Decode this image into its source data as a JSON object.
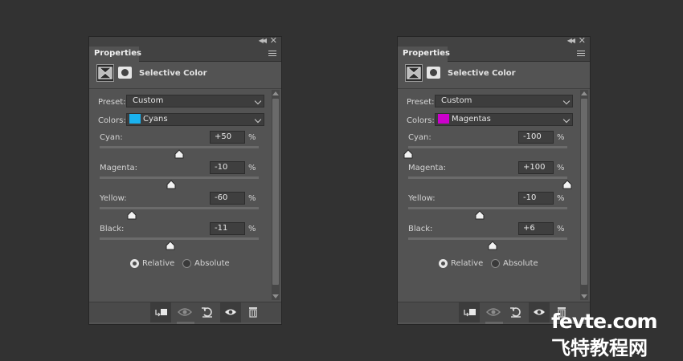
{
  "panels": [
    {
      "tab": "Properties",
      "adjustment_title": "Selective Color",
      "preset_label": "Preset:",
      "preset_value": "Custom",
      "colors_label": "Colors:",
      "colors_value": "Cyans",
      "colors_swatch": "#1ab2ef",
      "sliders": [
        {
          "label": "Cyan:",
          "value": "+50",
          "unit": "%",
          "position": 0.5
        },
        {
          "label": "Magenta:",
          "value": "-10",
          "unit": "%",
          "position": 0.45
        },
        {
          "label": "Yellow:",
          "value": "-60",
          "unit": "%",
          "position": 0.2
        },
        {
          "label": "Black:",
          "value": "-11",
          "unit": "%",
          "position": 0.445
        }
      ],
      "method_relative": "Relative",
      "method_absolute": "Absolute",
      "method_selected": "Relative"
    },
    {
      "tab": "Properties",
      "adjustment_title": "Selective Color",
      "preset_label": "Preset:",
      "preset_value": "Custom",
      "colors_label": "Colors:",
      "colors_value": "Magentas",
      "colors_swatch": "#cc00cc",
      "sliders": [
        {
          "label": "Cyan:",
          "value": "-100",
          "unit": "%",
          "position": 0.0
        },
        {
          "label": "Magenta:",
          "value": "+100",
          "unit": "%",
          "position": 1.0
        },
        {
          "label": "Yellow:",
          "value": "-10",
          "unit": "%",
          "position": 0.45
        },
        {
          "label": "Black:",
          "value": "+6",
          "unit": "%",
          "position": 0.53
        }
      ],
      "method_relative": "Relative",
      "method_absolute": "Absolute",
      "method_selected": "Relative"
    }
  ],
  "icons": {
    "collapse": "double-chevron-left-icon",
    "close": "close-icon",
    "menu": "panel-menu-icon",
    "adjustment": "selective-color-layer-icon",
    "mask": "layer-mask-icon",
    "clip": "clip-to-layer-icon",
    "view_previous": "view-previous-state-icon",
    "reset": "reset-icon",
    "visibility": "eye-icon",
    "delete": "trash-icon"
  },
  "watermark": {
    "line1": "fevte.com",
    "line2": "飞特教程网"
  }
}
